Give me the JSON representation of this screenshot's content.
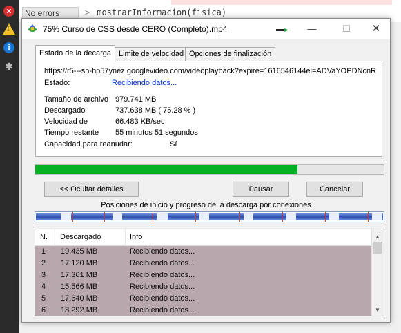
{
  "ide": {
    "no_errors_label": "No errors",
    "code_text": "mostrarInformacion(fisica)",
    "prompt": ">"
  },
  "dialog": {
    "title": "75% Curso de CSS desde CERO (Completo).mp4",
    "minimize": "—",
    "maximize": "☐",
    "close": "✕",
    "tabs": [
      {
        "label": "Estado de la decarga",
        "active": true
      },
      {
        "label": "Limite de velocidad",
        "active": false
      },
      {
        "label": "Opciones de finalización",
        "active": false
      }
    ],
    "url": "https://r5---sn-hp57ynez.googlevideo.com/videoplayback?expire=1616546144ei=ADVaYOPDNcnR",
    "status_label": "Estado:",
    "status_value": "Recibiendo datos...",
    "info": [
      {
        "label": "Tamaño de archivo",
        "value": "979.741  MB"
      },
      {
        "label": "Descargado",
        "value": "737.638  MB  ( 75.28 % )"
      },
      {
        "label": "Velocidad de",
        "value": "66.483  KB/sec"
      },
      {
        "label": "Tiempo restante",
        "value": "55 minutos 51 segundos"
      },
      {
        "label": "Capacidad para reanudar:",
        "value": "Sí"
      }
    ],
    "progress_percent": 75.28,
    "buttons": {
      "hide_details": "<< Ocultar detalles",
      "pause": "Pausar",
      "cancel": "Cancelar"
    },
    "connections_caption": "Posiciones de inicio y progreso de la descarga por conexiones",
    "table": {
      "headers": [
        "N.",
        "Descargado",
        "Info"
      ],
      "rows": [
        {
          "n": "1",
          "downloaded": "19.435  MB",
          "info": "Recibiendo datos..."
        },
        {
          "n": "2",
          "downloaded": "17.120  MB",
          "info": "Recibiendo datos..."
        },
        {
          "n": "3",
          "downloaded": "17.361  MB",
          "info": "Recibiendo datos..."
        },
        {
          "n": "4",
          "downloaded": "15.566  MB",
          "info": "Recibiendo datos..."
        },
        {
          "n": "5",
          "downloaded": "17.640  MB",
          "info": "Recibiendo datos..."
        },
        {
          "n": "6",
          "downloaded": "18.292  MB",
          "info": "Recibiendo datos..."
        }
      ]
    }
  },
  "colors": {
    "progress": "#06b025",
    "row_selected": "#b8a7ac",
    "status_link": "#0033cc"
  }
}
